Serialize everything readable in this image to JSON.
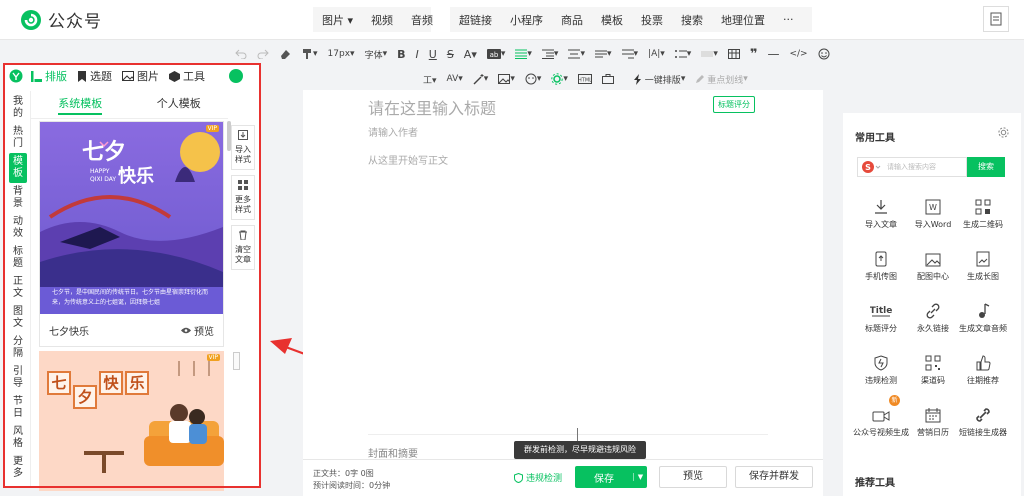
{
  "brand": {
    "name": "公众号",
    "color": "#07c160"
  },
  "top_insert": {
    "group1": [
      {
        "label": "图片",
        "caret": true
      },
      {
        "label": "视频",
        "caret": false
      },
      {
        "label": "音频",
        "caret": false
      }
    ],
    "group2": [
      {
        "label": "超链接",
        "caret": false
      },
      {
        "label": "小程序",
        "caret": false
      },
      {
        "label": "商品",
        "caret": false
      },
      {
        "label": "模板",
        "caret": false
      },
      {
        "label": "投票",
        "caret": false
      },
      {
        "label": "搜索",
        "caret": false
      },
      {
        "label": "地理位置",
        "caret": false
      },
      {
        "label": "···",
        "caret": false
      }
    ]
  },
  "toolbar": {
    "font_size": "17px",
    "font_family": "字体",
    "one_click": "一键排版",
    "highlight": "重点划线"
  },
  "left_panel": {
    "tabs": [
      {
        "label": "排版",
        "icon": "layout-icon",
        "active": true
      },
      {
        "label": "选题",
        "icon": "bookmark-icon",
        "active": false
      },
      {
        "label": "图片",
        "icon": "image-icon",
        "active": false
      },
      {
        "label": "工具",
        "icon": "cube-icon",
        "active": false
      }
    ],
    "vertical_nav": [
      {
        "label": "我的",
        "active": false
      },
      {
        "label": "热门",
        "active": false
      },
      {
        "label": "模板",
        "active": true
      },
      {
        "label": "背景",
        "active": false
      },
      {
        "label": "动效",
        "active": false
      },
      {
        "label": "标题",
        "active": false
      },
      {
        "label": "正文",
        "active": false
      },
      {
        "label": "图文",
        "active": false
      },
      {
        "label": "分隔",
        "active": false
      },
      {
        "label": "引导",
        "active": false
      },
      {
        "label": "节日",
        "active": false
      },
      {
        "label": "风格",
        "active": false
      },
      {
        "label": "更多",
        "active": false
      }
    ],
    "template_tabs": [
      {
        "label": "系统模板",
        "active": true
      },
      {
        "label": "个人模板",
        "active": false
      }
    ],
    "card1": {
      "title_main": "七夕",
      "title_sub": "快乐",
      "en_line1": "HAPPY",
      "en_line2": "QIXI DAY",
      "vip": "VIP",
      "body_text": "七夕节，是中国民间的传统节日。七夕节由星宿崇拜衍化而来，为传统意义上的七姐诞，因拜祭七姐",
      "name": "七夕快乐",
      "preview": "预览"
    },
    "card2": {
      "chars": [
        "七",
        "夕",
        "快",
        "乐"
      ],
      "vip": "VIP"
    },
    "side_actions": [
      {
        "label": "导入样式",
        "icon": "import-icon"
      },
      {
        "label": "更多样式",
        "icon": "grid-icon"
      },
      {
        "label": "清空文章",
        "icon": "trash-icon"
      }
    ]
  },
  "editor": {
    "title_placeholder": "请在这里输入标题",
    "score_button": "标题评分",
    "author_placeholder": "请输入作者",
    "body_placeholder": "从这里开始写正文",
    "cover_label": "封面和摘要",
    "tooltip": "群发前检测，尽早规避违规风险"
  },
  "bottom": {
    "word_count_label": "正文共：",
    "word_count": "0字 0图",
    "read_time_label": "预计阅读时间：",
    "read_time": "0分钟",
    "check": "违规检测",
    "save": "保存",
    "preview": "预览",
    "save_send": "保存并群发"
  },
  "right_panel": {
    "title": "常用工具",
    "search_placeholder": "请输入搜索内容",
    "search_button": "搜索",
    "badge": "新",
    "tools": [
      {
        "label": "导入文章",
        "icon": "import-article-icon"
      },
      {
        "label": "导入Word",
        "icon": "word-icon"
      },
      {
        "label": "生成二维码",
        "icon": "qrcode-icon"
      },
      {
        "label": "手机传图",
        "icon": "phone-upload-icon"
      },
      {
        "label": "配图中心",
        "icon": "picture-center-icon"
      },
      {
        "label": "生成长图",
        "icon": "long-image-icon"
      },
      {
        "label": "标题评分",
        "icon": "title-score-icon"
      },
      {
        "label": "永久链接",
        "icon": "link-icon"
      },
      {
        "label": "生成文章音频",
        "icon": "audio-icon"
      },
      {
        "label": "违规检测",
        "icon": "shield-check-icon"
      },
      {
        "label": "渠道码",
        "icon": "channel-code-icon"
      },
      {
        "label": "往期推荐",
        "icon": "thumbs-up-icon"
      },
      {
        "label": "公众号视频生成",
        "icon": "video-gen-icon"
      },
      {
        "label": "营销日历",
        "icon": "calendar-icon"
      },
      {
        "label": "短链接生成器",
        "icon": "short-link-icon"
      }
    ],
    "title2": "推荐工具"
  }
}
